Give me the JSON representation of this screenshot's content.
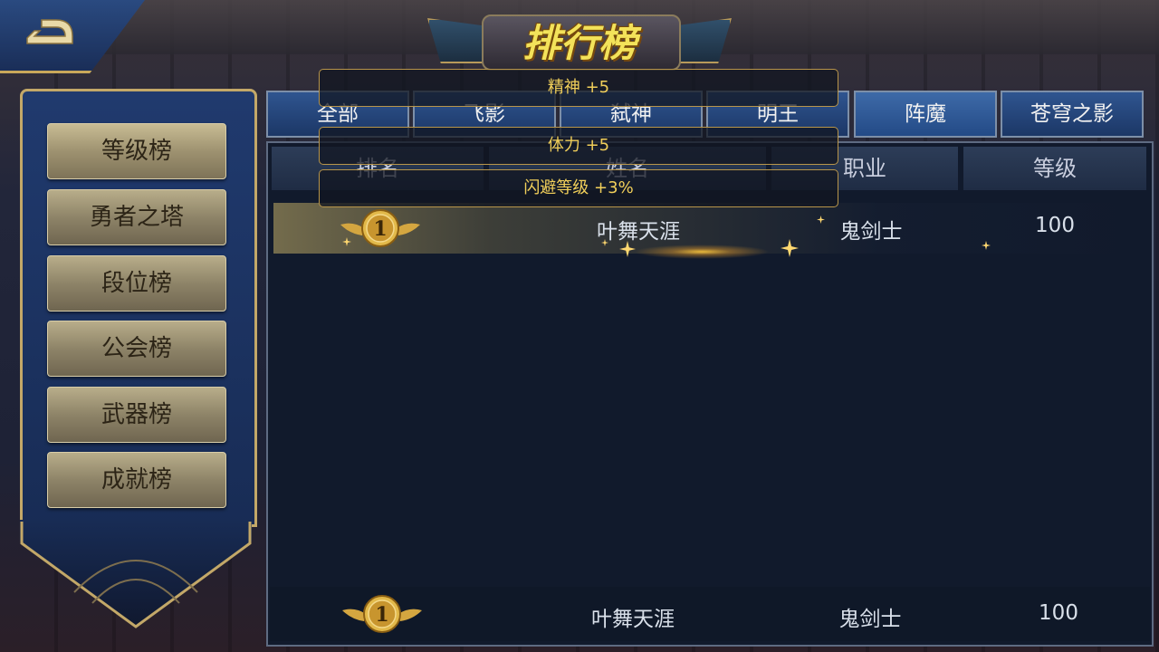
{
  "title": "排行榜",
  "sidebar": {
    "items": [
      {
        "label": "等级榜"
      },
      {
        "label": "勇者之塔"
      },
      {
        "label": "段位榜"
      },
      {
        "label": "公会榜"
      },
      {
        "label": "武器榜"
      },
      {
        "label": "成就榜"
      }
    ]
  },
  "tabs": [
    {
      "label": "全部"
    },
    {
      "label": "飞影"
    },
    {
      "label": "弑神"
    },
    {
      "label": "明王"
    },
    {
      "label": "阵魔"
    },
    {
      "label": "苍穹之影"
    }
  ],
  "table": {
    "headers": {
      "rank": "排名",
      "name": "姓名",
      "class": "职业",
      "level": "等级"
    },
    "rows": [
      {
        "rank": "1",
        "name": "叶舞天涯",
        "class": "鬼剑士",
        "level": "100"
      }
    ],
    "self_row": {
      "rank": "1",
      "name": "叶舞天涯",
      "class": "鬼剑士",
      "level": "100"
    }
  },
  "tooltips": {
    "spirit": "精神 +5",
    "stamina": "体力 +5",
    "dodge": "闪避等级 +3%"
  },
  "colors": {
    "accent_gold": "#c9a85a",
    "tooltip_text": "#f1cf5a",
    "tab_blue": "#2f5590",
    "panel_bg": "#111a2c"
  }
}
